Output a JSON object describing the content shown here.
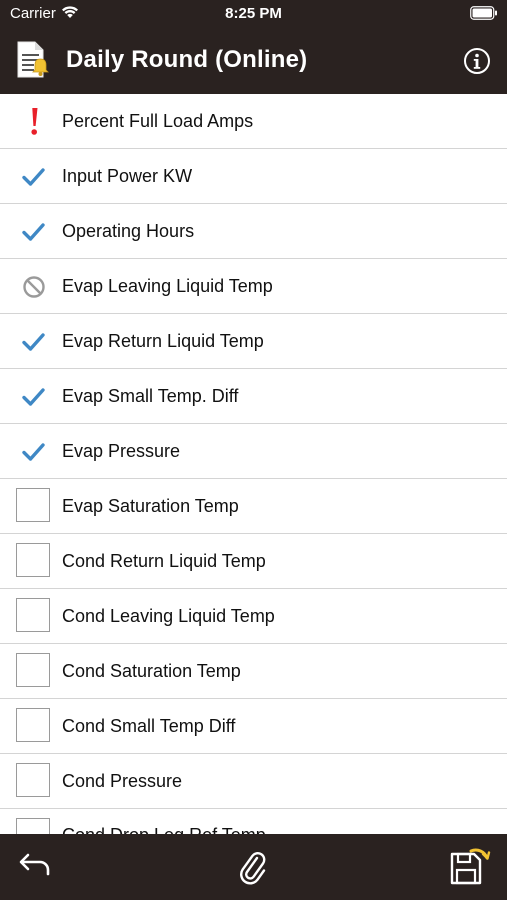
{
  "status_bar": {
    "carrier": "Carrier",
    "time": "8:25 PM"
  },
  "nav": {
    "title": "Daily Round (Online)",
    "left_icon": "document-bell-icon",
    "right_icon": "info-icon"
  },
  "colors": {
    "bar_background": "#2a2220",
    "check": "#3f88c5",
    "alert": "#e8202a",
    "skipped": "#9a9a9a"
  },
  "items": [
    {
      "label": "Percent Full Load Amps",
      "status": "alert"
    },
    {
      "label": "Input Power KW",
      "status": "checked"
    },
    {
      "label": "Operating Hours",
      "status": "checked"
    },
    {
      "label": "Evap Leaving Liquid Temp",
      "status": "skipped"
    },
    {
      "label": "Evap Return Liquid Temp",
      "status": "checked"
    },
    {
      "label": "Evap Small Temp. Diff",
      "status": "checked"
    },
    {
      "label": "Evap Pressure",
      "status": "checked"
    },
    {
      "label": "Evap Saturation Temp",
      "status": "empty"
    },
    {
      "label": "Cond Return Liquid Temp",
      "status": "empty"
    },
    {
      "label": "Cond Leaving Liquid Temp",
      "status": "empty"
    },
    {
      "label": "Cond Saturation Temp",
      "status": "empty"
    },
    {
      "label": "Cond Small Temp Diff",
      "status": "empty"
    },
    {
      "label": "Cond Pressure",
      "status": "empty"
    },
    {
      "label": "Cond Drop Leg Ref Temp",
      "status": "empty"
    }
  ],
  "toolbar": {
    "back_icon": "back-arrow-icon",
    "attach_icon": "paperclip-icon",
    "save_icon": "save-disk-icon"
  }
}
